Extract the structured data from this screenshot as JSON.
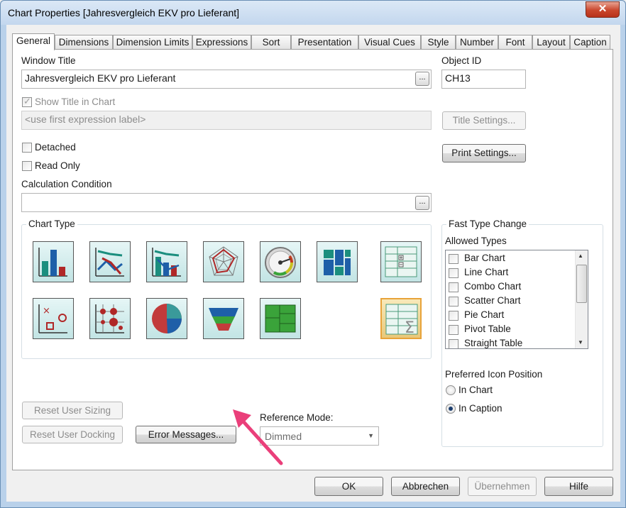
{
  "window": {
    "title": "Chart Properties [Jahresvergleich EKV pro Lieferant]",
    "close_icon": "close-icon"
  },
  "tabs": [
    {
      "label": "General",
      "active": true
    },
    {
      "label": "Dimensions"
    },
    {
      "label": "Dimension Limits"
    },
    {
      "label": "Expressions"
    },
    {
      "label": "Sort"
    },
    {
      "label": "Presentation"
    },
    {
      "label": "Visual Cues"
    },
    {
      "label": "Style"
    },
    {
      "label": "Number"
    },
    {
      "label": "Font"
    },
    {
      "label": "Layout"
    },
    {
      "label": "Caption"
    }
  ],
  "general": {
    "window_title_label": "Window Title",
    "window_title_value": "Jahresvergleich EKV pro Lieferant",
    "ellipsis": "...",
    "object_id_label": "Object ID",
    "object_id_value": "CH13",
    "show_title_label": "Show Title in Chart",
    "title_placeholder": "<use first expression label>",
    "title_settings": "Title Settings...",
    "print_settings": "Print Settings...",
    "detached": "Detached",
    "read_only": "Read Only",
    "calc_condition_label": "Calculation Condition",
    "calc_condition_value": "",
    "chart_type_label": "Chart Type",
    "chart_types": [
      "bar-chart-icon",
      "line-chart-icon",
      "combo-chart-icon",
      "radar-chart-icon",
      "gauge-chart-icon",
      "mekko-chart-icon",
      "pivot-table-icon",
      "scatter-chart-icon",
      "grid-chart-icon",
      "pie-chart-icon",
      "funnel-chart-icon",
      "block-chart-icon",
      "straight-table-icon"
    ],
    "selected_chart_type": "straight-table-icon",
    "fast_type_change_label": "Fast Type Change",
    "allowed_types_label": "Allowed Types",
    "allowed_types": [
      "Bar Chart",
      "Line Chart",
      "Combo Chart",
      "Scatter Chart",
      "Pie Chart",
      "Pivot Table",
      "Straight Table"
    ],
    "preferred_icon_position_label": "Preferred Icon Position",
    "in_chart": "In Chart",
    "in_caption": "In Caption",
    "preferred_icon_position": "In Caption",
    "reset_user_sizing": "Reset User Sizing",
    "reset_user_docking": "Reset User Docking",
    "error_messages": "Error Messages...",
    "reference_mode_label": "Reference Mode:",
    "reference_mode_value": "Dimmed"
  },
  "footer": {
    "ok": "OK",
    "cancel": "Abbrechen",
    "apply": "Übernehmen",
    "help": "Hilfe"
  },
  "annotation": {
    "arrow_color": "#ea3f7a"
  }
}
